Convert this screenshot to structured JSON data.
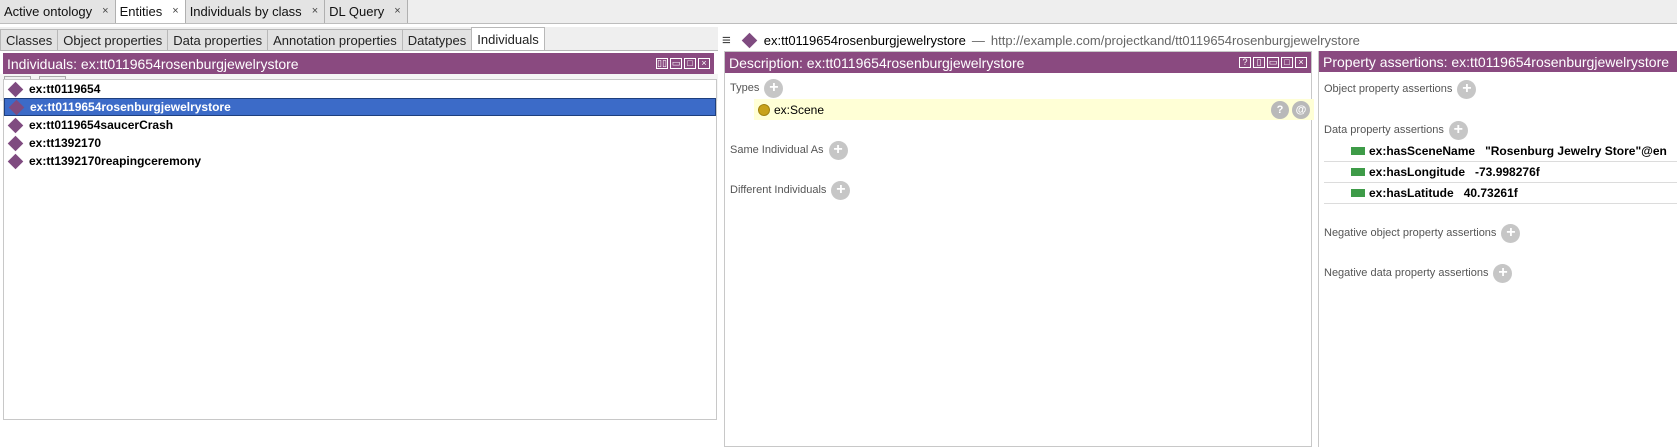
{
  "top_tabs": [
    {
      "label": "Active ontology",
      "active": false
    },
    {
      "label": "Entities",
      "active": true
    },
    {
      "label": "Individuals by class",
      "active": false
    },
    {
      "label": "DL Query",
      "active": false
    }
  ],
  "sub_tabs": [
    {
      "label": "Classes"
    },
    {
      "label": "Object properties"
    },
    {
      "label": "Data properties"
    },
    {
      "label": "Annotation properties"
    },
    {
      "label": "Datatypes"
    },
    {
      "label": "Individuals",
      "active": true
    }
  ],
  "individuals_view": {
    "title": "Individuals: ex:tt0119654rosenburgjewelrystore",
    "items": [
      {
        "label": "ex:tt0119654",
        "selected": false
      },
      {
        "label": "ex:tt0119654rosenburgjewelrystore",
        "selected": true
      },
      {
        "label": "ex:tt0119654saucerCrash",
        "selected": false
      },
      {
        "label": "ex:tt1392170",
        "selected": false
      },
      {
        "label": "ex:tt1392170reapingceremony",
        "selected": false
      }
    ]
  },
  "breadcrumb": {
    "name": "ex:tt0119654rosenburgjewelrystore",
    "separator": "—",
    "iri": "http://example.com/projectkand/tt0119654rosenburgjewelrystore"
  },
  "description": {
    "title": "Description: ex:tt0119654rosenburgjewelrystore",
    "types_label": "Types",
    "type_value": "ex:Scene",
    "same_label": "Same Individual As",
    "different_label": "Different Individuals"
  },
  "property_assertions": {
    "title": "Property assertions: ex:tt0119654rosenburgjewelrystore",
    "object_label": "Object property assertions",
    "data_label": "Data property assertions",
    "data_rows": [
      {
        "property": "ex:hasSceneName",
        "value": "\"Rosenburg Jewelry Store\"@en"
      },
      {
        "property": "ex:hasLongitude",
        "value": "-73.998276f"
      },
      {
        "property": "ex:hasLatitude",
        "value": "40.73261f"
      }
    ],
    "neg_object_label": "Negative object property assertions",
    "neg_data_label": "Negative data property assertions"
  },
  "colors": {
    "view_header": "#8a4a80",
    "selection": "#3c6bc8",
    "individual_icon": "#7f4b80",
    "class_icon": "#c8a21a",
    "data_property_icon": "#3e9b48"
  },
  "icons": {
    "tab_close": "close-icon",
    "add_individual": "add-individual-icon",
    "delete_individual": "delete-individual-icon",
    "individual": "individual-diamond-icon",
    "class": "class-circle-icon",
    "data_property": "data-property-icon",
    "add": "plus-icon",
    "explain": "question-icon",
    "annotate": "at-icon",
    "menu": "hamburger-icon"
  },
  "glyphs": {
    "close": "×",
    "plus": "+",
    "question": "?",
    "at": "@"
  }
}
